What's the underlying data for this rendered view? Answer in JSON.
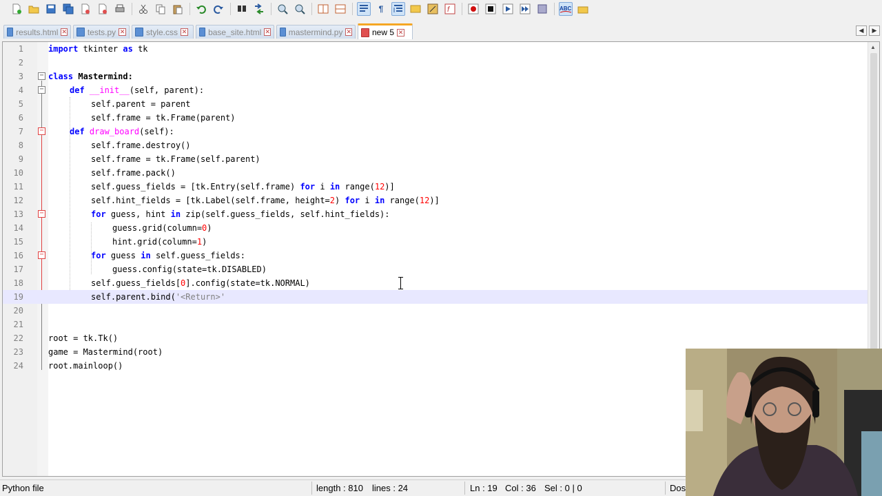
{
  "toolbar": {
    "icons": [
      "new-file-icon",
      "open-file-icon",
      "save-icon",
      "save-all-icon",
      "close-icon",
      "close-all-icon",
      "print-icon",
      "cut-icon",
      "copy-icon",
      "paste-icon",
      "undo-icon",
      "redo-icon",
      "find-icon",
      "replace-icon",
      "zoom-in-icon",
      "zoom-out-icon",
      "sync-v-icon",
      "sync-h-icon",
      "word-wrap-icon",
      "show-all-chars-icon",
      "indent-guide-icon",
      "folder-icon",
      "doc-map-icon",
      "function-list-icon",
      "record-macro-icon",
      "stop-record-icon",
      "play-macro-icon",
      "run-multiple-icon",
      "save-macro-icon",
      "spellcheck-icon",
      "spellcheck-settings-icon"
    ]
  },
  "tabs": [
    {
      "label": "results.html",
      "active": false
    },
    {
      "label": "tests.py",
      "active": false
    },
    {
      "label": "style.css",
      "active": false
    },
    {
      "label": "base_site.html",
      "active": false
    },
    {
      "label": "mastermind.py",
      "active": false
    },
    {
      "label": "new 5",
      "active": true
    }
  ],
  "editor": {
    "line_numbers": [
      "1",
      "2",
      "3",
      "4",
      "5",
      "6",
      "7",
      "8",
      "9",
      "10",
      "11",
      "12",
      "13",
      "14",
      "15",
      "16",
      "17",
      "18",
      "19",
      "20",
      "21",
      "22",
      "23",
      "24"
    ],
    "current_line": 19
  },
  "code": {
    "l1": {
      "kw1": "import",
      "t1": " tkinter ",
      "kw2": "as",
      "t2": " tk"
    },
    "l3": {
      "kw": "class",
      "name": " Mastermind:"
    },
    "l4": {
      "kw": "def",
      "fn": " __init__",
      "rest": "(self, parent):"
    },
    "l5": "self.parent = parent",
    "l6": "self.frame = tk.Frame(parent)",
    "l7": {
      "kw": "def",
      "fn": " draw_board",
      "rest": "(self):"
    },
    "l8": "self.frame.destroy()",
    "l9": "self.frame = tk.Frame(self.parent)",
    "l10": "self.frame.pack()",
    "l11": {
      "a": "self.guess_fields = [tk.Entry(self.frame) ",
      "kw1": "for",
      "b": " i ",
      "kw2": "in",
      "c": " range(",
      "n": "12",
      "d": ")]"
    },
    "l12": {
      "a": "self.hint_fields = [tk.Label(self.frame, height=",
      "n1": "2",
      "b": ") ",
      "kw1": "for",
      "c": " i ",
      "kw2": "in",
      "d": " range(",
      "n2": "12",
      "e": ")]"
    },
    "l13": {
      "kw1": "for",
      "a": " guess, hint ",
      "kw2": "in",
      "b": " zip(self.guess_fields, self.hint_fields):"
    },
    "l14": {
      "a": "guess.grid(column=",
      "n": "0",
      "b": ")"
    },
    "l15": {
      "a": "hint.grid(column=",
      "n": "1",
      "b": ")"
    },
    "l16": {
      "kw1": "for",
      "a": " guess ",
      "kw2": "in",
      "b": " self.guess_fields:"
    },
    "l17": "guess.config(state=tk.DISABLED)",
    "l18": {
      "a": "self.guess_fields[",
      "n": "0",
      "b": "].config(state=tk.NORMAL)"
    },
    "l19": {
      "a": "self.parent.bind(",
      "s": "'<Return>'"
    },
    "l22": "root = tk.Tk()",
    "l23": "game = Mastermind(root)",
    "l24": "root.mainloop()"
  },
  "statusbar": {
    "file_type": "Python file",
    "length": "length : 810",
    "lines": "lines : 24",
    "ln": "Ln : 19",
    "col": "Col : 36",
    "sel": "Sel : 0 | 0",
    "eol": "Dos"
  }
}
